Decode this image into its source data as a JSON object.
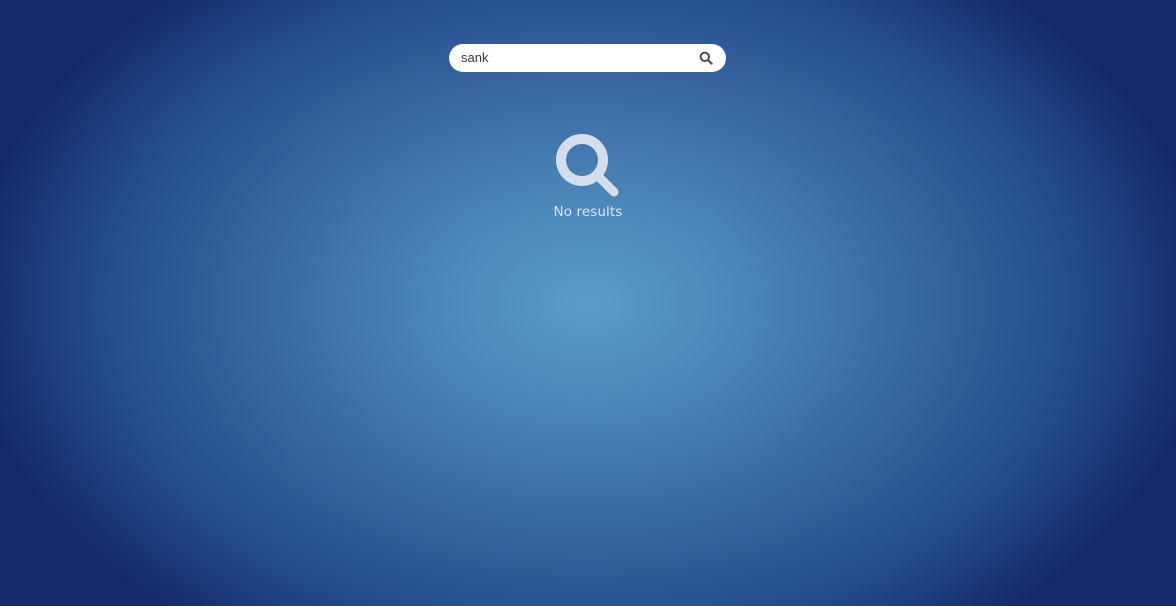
{
  "search": {
    "value": "sank",
    "icon": "search-icon"
  },
  "empty_state": {
    "icon": "magnifier-icon",
    "message": "No results"
  },
  "colors": {
    "background_center": "#5a9cc8",
    "background_edge": "#14296b",
    "search_bar": "#ffffff",
    "icon_light": "#d5deec"
  }
}
